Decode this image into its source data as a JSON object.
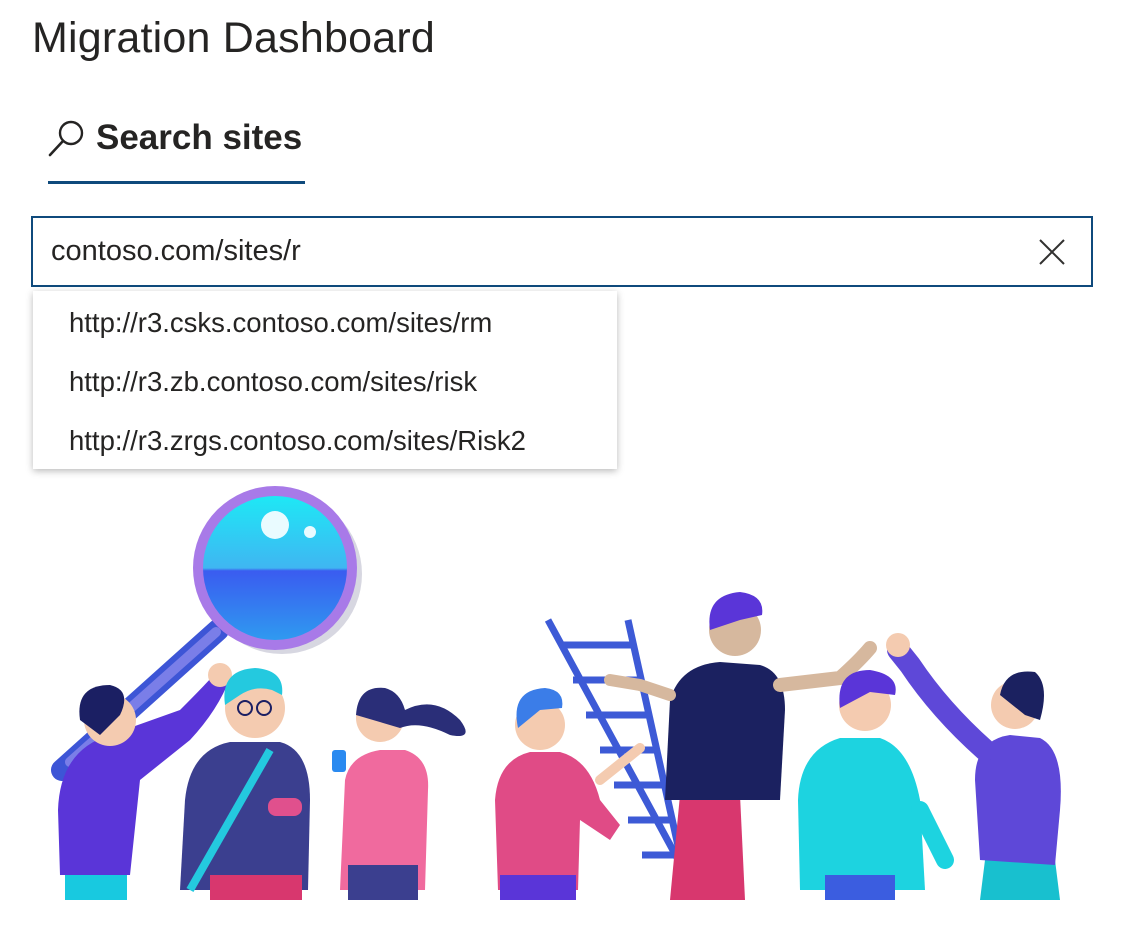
{
  "page": {
    "title": "Migration Dashboard"
  },
  "tabs": [
    {
      "label": "Search sites",
      "icon": "search-icon",
      "active": true
    }
  ],
  "search": {
    "value": "contoso.com/sites/r",
    "placeholder": "",
    "clear_icon": "close-icon"
  },
  "suggestions": [
    {
      "label": "http://r3.csks.contoso.com/sites/rm"
    },
    {
      "label": "http://r3.zb.contoso.com/sites/risk"
    },
    {
      "label": "http://r3.zrgs.contoso.com/sites/Risk2"
    }
  ],
  "colors": {
    "accent": "#0f4a7c",
    "text": "#252423"
  },
  "illustration": {
    "name": "people-search-illustration"
  }
}
